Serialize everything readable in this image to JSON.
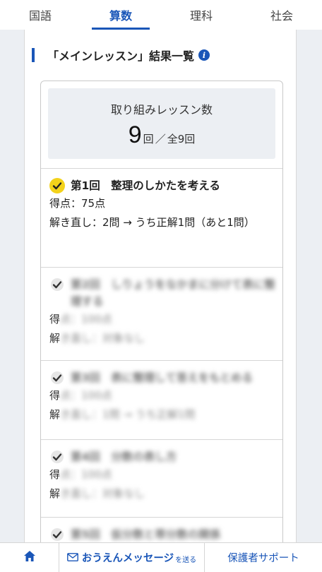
{
  "tabs": [
    {
      "label": "国語",
      "active": false
    },
    {
      "label": "算数",
      "active": true
    },
    {
      "label": "理科",
      "active": false
    },
    {
      "label": "社会",
      "active": false
    }
  ],
  "section": {
    "title": "「メインレッスン」結果一覧",
    "info_icon": "info-icon"
  },
  "lesson_count": {
    "label": "取り組みレッスン数",
    "done": "9",
    "unit": "回",
    "separator": "／",
    "total": "全9回"
  },
  "lessons": [
    {
      "title": "第1回　整理のしかたを考える",
      "score": "得点：75点",
      "review": "解き直し：2問 → うち正解1問（あと1問）",
      "status": "completed",
      "blurred": false
    },
    {
      "title": "第2回　しりょうをなかまに分けて表に整理する",
      "score_prefix": "得",
      "score_rest": "点：100点",
      "review_prefix": "解",
      "review_rest": "き直し：対象なし",
      "status": "completed",
      "blurred": true
    },
    {
      "title": "第3回　表に整理して答えをもとめる",
      "score_prefix": "得",
      "score_rest": "点：100点",
      "review_prefix": "解",
      "review_rest": "き直し：1問 → うち正解1問",
      "status": "completed",
      "blurred": true
    },
    {
      "title": "第4回　分数の表し方",
      "score_prefix": "得",
      "score_rest": "点：100点",
      "review_prefix": "解",
      "review_rest": "き直し：対象なし",
      "status": "completed",
      "blurred": true
    },
    {
      "title": "第5回　仮分数と帯分数の関係",
      "status": "completed",
      "blurred": true
    }
  ],
  "bottom_nav": {
    "home_icon": "home-icon",
    "message_icon": "mail-icon",
    "message_label": "おうえんメッセージ",
    "message_suffix": "を送る",
    "support_label": "保護者サポート"
  },
  "colors": {
    "accent": "#1a56b8",
    "check_yellow": "#f3d21a",
    "gutter": "#eceff3"
  }
}
